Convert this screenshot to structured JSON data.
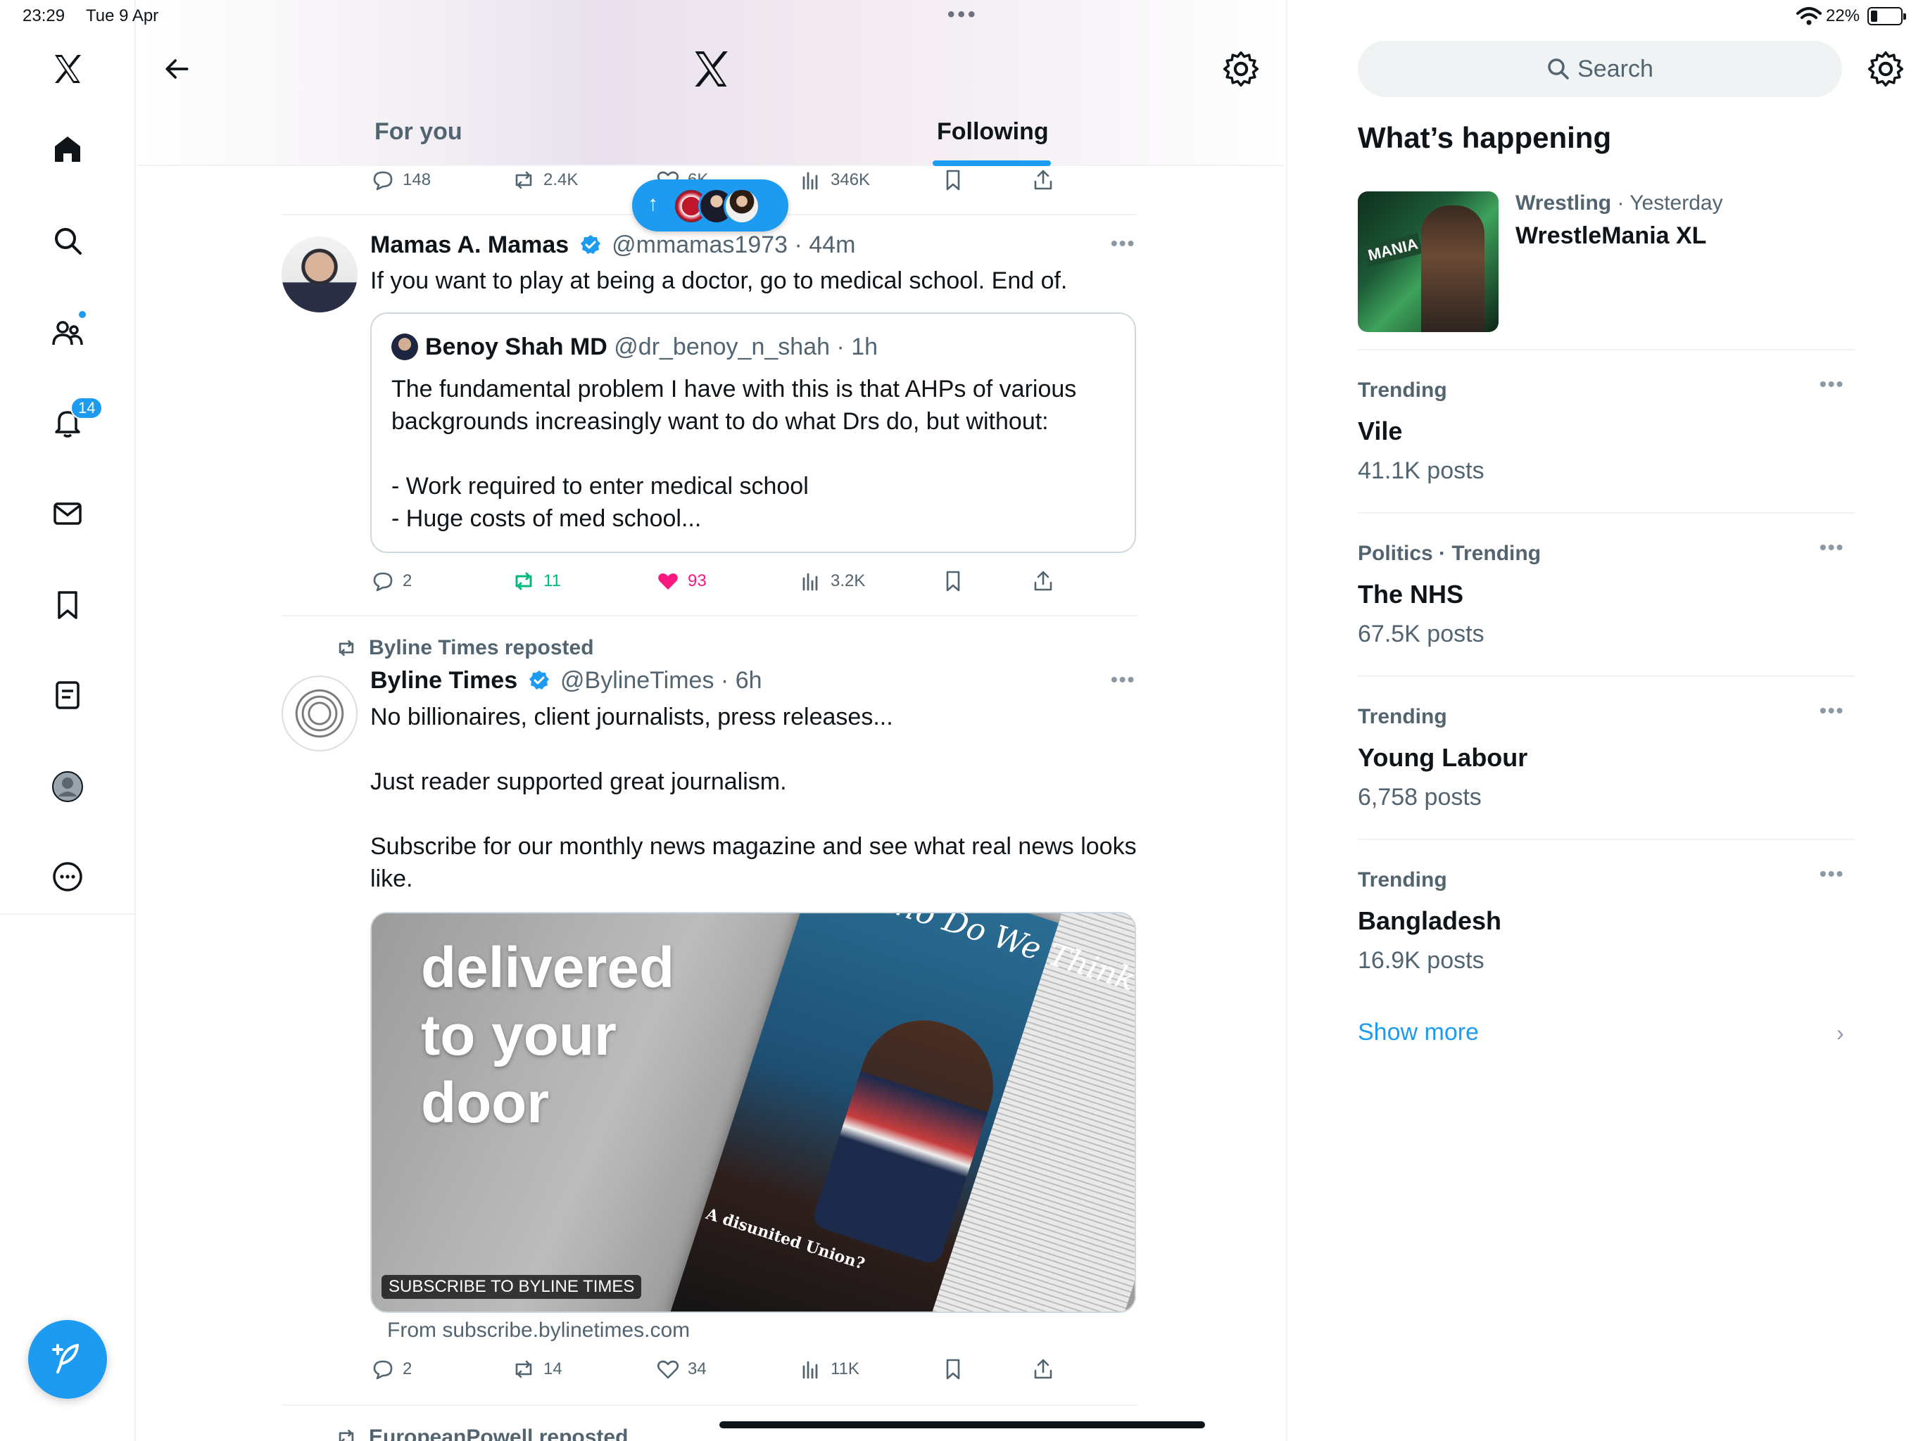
{
  "status_bar": {
    "time": "23:29",
    "date": "Tue 9 Apr",
    "battery": "22%"
  },
  "nav": {
    "notifications_badge": "14",
    "items": [
      "x-logo",
      "home",
      "search",
      "communities",
      "notifications",
      "messages",
      "bookmarks",
      "lists",
      "profile",
      "more"
    ]
  },
  "header": {
    "tabs": [
      {
        "label": "For you",
        "active": false
      },
      {
        "label": "Following",
        "active": true
      }
    ]
  },
  "feed": {
    "top_tweet_actions": {
      "replies": "148",
      "reposts": "2.4K",
      "likes": "6K",
      "views": "346K"
    },
    "tweets": [
      {
        "name": "Mamas A. Mamas",
        "handle": "@mmamas1973",
        "time": "44m",
        "text": "If you want to play at being a doctor, go to medical school. End of.",
        "quote": {
          "name": "Benoy Shah MD",
          "handle": "@dr_benoy_n_shah",
          "time": "1h",
          "text_lines": [
            "The fundamental problem I have with this is that AHPs of various backgrounds increasingly want to do what Drs do, but without:",
            "- Work required to enter medical school",
            "- Huge costs of med school..."
          ]
        },
        "actions": {
          "replies": "2",
          "reposts": "11",
          "likes": "93",
          "views": "3.2K"
        }
      },
      {
        "repost_label": "Byline Times reposted",
        "name": "Byline Times",
        "handle": "@BylineTimes",
        "time": "6h",
        "text_lines": [
          "No billionaires, client journalists, press releases...",
          "Just reader supported great journalism.",
          "Subscribe for our monthly news magazine and see what real news looks like."
        ],
        "media": {
          "headline": "delivered\nto your\ndoor",
          "magazine_title": "Who Do We Think We Are?",
          "magazine_caption": "A disunited Union?",
          "ad_label": "SUBSCRIBE TO BYLINE TIMES"
        },
        "from_link": "From subscribe.bylinetimes.com",
        "actions": {
          "replies": "2",
          "reposts": "14",
          "likes": "34",
          "views": "11K"
        }
      },
      {
        "repost_label": "EuropeanPowell reposted"
      }
    ]
  },
  "sidebar": {
    "search_placeholder": "Search",
    "section_title": "What’s happening",
    "event": {
      "category": "Wrestling",
      "time": "Yesterday",
      "title": "WrestleMania XL",
      "thumb_text": "MANIA"
    },
    "trends": [
      {
        "category": "Trending",
        "name": "Vile",
        "count": "41.1K posts"
      },
      {
        "category": "Politics · Trending",
        "name": "The NHS",
        "count": "67.5K posts"
      },
      {
        "category": "Trending",
        "name": "Young Labour",
        "count": "6,758 posts"
      },
      {
        "category": "Trending",
        "name": "Bangladesh",
        "count": "16.9K posts"
      }
    ],
    "show_more": "Show more"
  },
  "colors": {
    "accent": "#1d9bf0",
    "retweet": "#00ba7c",
    "like": "#f91880",
    "secondary_text": "#536471"
  }
}
